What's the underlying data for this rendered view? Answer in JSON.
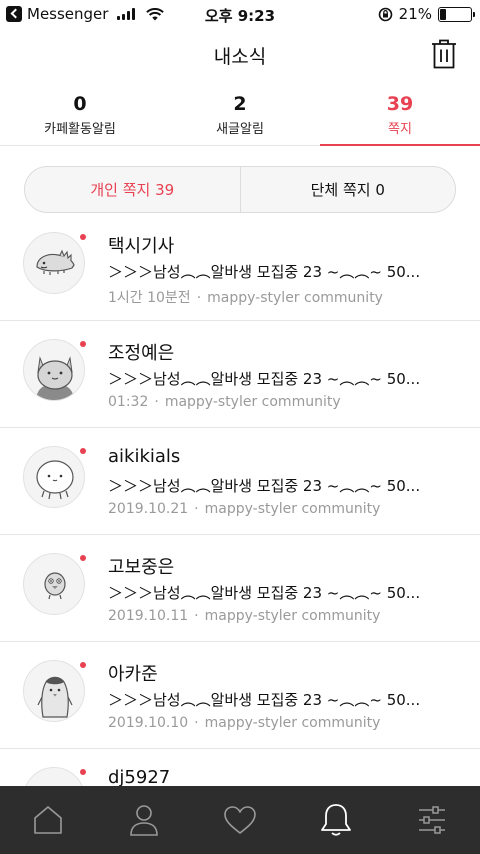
{
  "status_bar": {
    "app_name": "Messenger",
    "time": "오후 9:23",
    "battery_percent": "21%",
    "battery_level": 0.21
  },
  "header": {
    "title": "내소식"
  },
  "counters": [
    {
      "count": "0",
      "label": "카페활동알림",
      "active": false
    },
    {
      "count": "2",
      "label": "새글알림",
      "active": false
    },
    {
      "count": "39",
      "label": "쪽지",
      "active": true
    }
  ],
  "segment": {
    "personal_label": "개인 쪽지 39",
    "group_label": "단체 쪽지 0"
  },
  "messages": [
    {
      "name": "택시기사",
      "preview": "＞＞＞남성︵︵알바생 모집중 23 ~︵︵~ 50...",
      "time": "1시간 10분전",
      "source": "mappy-styler community",
      "unread": true,
      "avatar": "dinosaur"
    },
    {
      "name": "조정예은",
      "preview": "＞＞＞남성︵︵알바생 모집중 23 ~︵︵~ 50...",
      "time": "01:32",
      "source": "mappy-styler community",
      "unread": true,
      "avatar": "cat"
    },
    {
      "name": "aikikials",
      "preview": "＞＞＞남성︵︵알바생 모집중 23 ~︵︵~ 50...",
      "time": "2019.10.21",
      "source": "mappy-styler community",
      "unread": true,
      "avatar": "ghost"
    },
    {
      "name": "고보중은",
      "preview": "＞＞＞남성︵︵알바생 모집중 23 ~︵︵~ 50...",
      "time": "2019.10.11",
      "source": "mappy-styler community",
      "unread": true,
      "avatar": "chick"
    },
    {
      "name": "아카준",
      "preview": "＞＞＞남성︵︵알바생 모집중 23 ~︵︵~ 50...",
      "time": "2019.10.10",
      "source": "mappy-styler community",
      "unread": true,
      "avatar": "penguin"
    },
    {
      "name": "dj5927",
      "preview": "",
      "time": "",
      "source": "",
      "unread": true,
      "avatar": "blank"
    }
  ],
  "tabbar": [
    {
      "icon": "home-icon"
    },
    {
      "icon": "person-icon"
    },
    {
      "icon": "heart-icon"
    },
    {
      "icon": "bell-icon",
      "active": true
    },
    {
      "icon": "settings-sliders-icon"
    }
  ],
  "colors": {
    "accent": "#e84152",
    "tabbar_bg": "#2d2d2d",
    "meta_text": "#9a9a9a"
  }
}
